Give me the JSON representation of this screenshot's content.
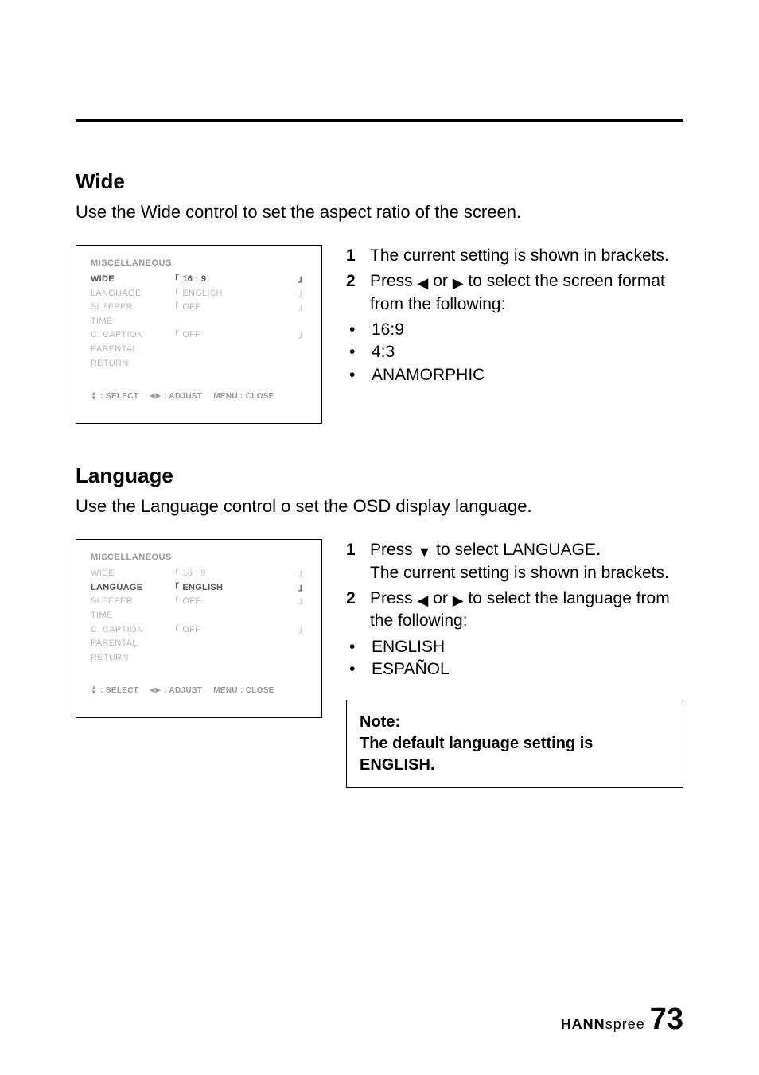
{
  "sections": {
    "wide": {
      "heading": "Wide",
      "desc": "Use the Wide control to set the aspect ratio of the screen.",
      "osd": {
        "title": "MISCELLANEOUS",
        "rows": [
          {
            "label": "WIDE",
            "value": "16 : 9",
            "emphasis": true,
            "brackets": true
          },
          {
            "label": "LANGUAGE",
            "value": "ENGLISH",
            "emphasis": false,
            "brackets": true
          },
          {
            "label": "SLEEPER",
            "value": "OFF",
            "emphasis": false,
            "brackets": true
          },
          {
            "label": "TIME",
            "value": "",
            "emphasis": false,
            "brackets": false
          },
          {
            "label": "C. CAPTION",
            "value": "OFF",
            "emphasis": false,
            "brackets": true
          },
          {
            "label": "PARENTAL",
            "value": "",
            "emphasis": false,
            "brackets": false
          },
          {
            "label": "RETURN",
            "value": "",
            "emphasis": false,
            "brackets": false
          }
        ],
        "footer": {
          "select": ": SELECT",
          "adjust": ": ADJUST",
          "menu": "MENU : CLOSE"
        }
      },
      "steps": [
        {
          "num": "1",
          "text_before": "The current setting is shown in brackets."
        },
        {
          "num": "2",
          "text_before": "Press ",
          "text_mid": " or ",
          "text_after": " to select the screen format from the following:"
        }
      ],
      "options": [
        "16:9",
        "4:3",
        "ANAMORPHIC"
      ]
    },
    "language": {
      "heading": "Language",
      "desc": "Use the Language control o set the OSD display language.",
      "osd": {
        "title": "MISCELLANEOUS",
        "rows": [
          {
            "label": "WIDE",
            "value": "16 : 9",
            "emphasis": false,
            "brackets": true
          },
          {
            "label": "LANGUAGE",
            "value": "ENGLISH",
            "emphasis": true,
            "brackets": true
          },
          {
            "label": "SLEEPER",
            "value": "OFF",
            "emphasis": false,
            "brackets": true
          },
          {
            "label": "TIME",
            "value": "",
            "emphasis": false,
            "brackets": false
          },
          {
            "label": "C. CAPTION",
            "value": "OFF",
            "emphasis": false,
            "brackets": true
          },
          {
            "label": "PARENTAL",
            "value": "",
            "emphasis": false,
            "brackets": false
          },
          {
            "label": "RETURN",
            "value": "",
            "emphasis": false,
            "brackets": false
          }
        ],
        "footer": {
          "select": ": SELECT",
          "adjust": ": ADJUST",
          "menu": "MENU : CLOSE"
        }
      },
      "steps": [
        {
          "num": "1",
          "text_before": "Press ",
          "text_after_icon": " to select LANGUAGE",
          "period": ".",
          "extra": "The current setting is shown in brackets."
        },
        {
          "num": "2",
          "text_before": "Press ",
          "text_mid": " or ",
          "text_after": " to select the language from the following:"
        }
      ],
      "options": [
        "ENGLISH",
        "ESPAÑOL"
      ],
      "note": {
        "label": "Note:",
        "text": "The default language setting is ENGLISH."
      }
    }
  },
  "footer": {
    "brand_bold": "HANN",
    "brand_rest": "spree",
    "page": "73"
  },
  "glyphs": {
    "left": "◀",
    "right": "▶",
    "down": "▼",
    "up": "▲",
    "lb": "「",
    "rb": "」"
  }
}
